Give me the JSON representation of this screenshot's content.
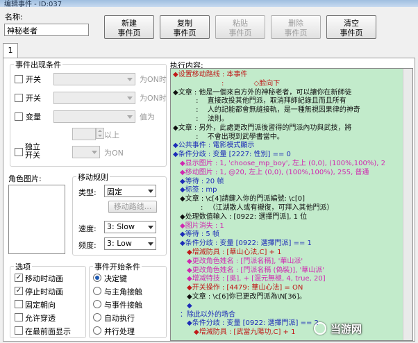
{
  "window": {
    "title": "编辑事件 - ID:037"
  },
  "name_field": {
    "label": "名称:",
    "value": "神秘老者"
  },
  "toolbar": {
    "buttons": [
      {
        "line1": "新建",
        "line2": "事件页",
        "enabled": true
      },
      {
        "line1": "复制",
        "line2": "事件页",
        "enabled": true
      },
      {
        "line1": "粘贴",
        "line2": "事件页",
        "enabled": false
      },
      {
        "line1": "删除",
        "line2": "事件页",
        "enabled": false
      },
      {
        "line1": "清空",
        "line2": "事件页",
        "enabled": true
      }
    ]
  },
  "tabs": [
    {
      "label": "1"
    }
  ],
  "conditions": {
    "title": "事件出现条件",
    "switch1": {
      "label": "开关",
      "suffix": "为ON时"
    },
    "switch2": {
      "label": "开关",
      "suffix": "为ON时"
    },
    "variable": {
      "label": "变量",
      "suffix": "值为",
      "above": "以上"
    },
    "self_switch": {
      "label1": "独立",
      "label2": "开关",
      "suffix": "为ON"
    }
  },
  "graphic": {
    "label": "角色图片:"
  },
  "movement": {
    "title": "移动规则",
    "type_label": "类型:",
    "type_value": "固定",
    "route_button": "移动路线...",
    "speed_label": "速度:",
    "speed_value": "3: Slow",
    "freq_label": "频度:",
    "freq_value": "3: Low"
  },
  "options": {
    "title": "选项",
    "items": [
      {
        "label": "移动时动画",
        "checked": true
      },
      {
        "label": "停止时动画",
        "checked": true
      },
      {
        "label": "固定朝向",
        "checked": false
      },
      {
        "label": "允许穿透",
        "checked": false
      },
      {
        "label": "在最前面显示",
        "checked": false
      }
    ]
  },
  "trigger": {
    "title": "事件开始条件",
    "items": [
      {
        "label": "决定键",
        "selected": true
      },
      {
        "label": "与主角接触",
        "selected": false
      },
      {
        "label": "与事件接触",
        "selected": false
      },
      {
        "label": "自动执行",
        "selected": false
      },
      {
        "label": "并行处理",
        "selected": false
      }
    ]
  },
  "contents": {
    "label": "执行内容:",
    "lines": [
      {
        "text": "◆设置移动路线 : 本事件",
        "color": "#c01818"
      },
      {
        "text": "　　　　　　　: 　　　　◇脸向下",
        "color": "#c01818"
      },
      {
        "text": "◆文章 : 他是一個來自方外的神秘老者，可以讓你在新師徒",
        "color": "#101010"
      },
      {
        "text": "　　　 : 　直接改投其他門派，取消拜師紀錄且而且所有",
        "color": "#101010"
      },
      {
        "text": "　　　 : 　人的記能都會無縫接軌，是一種無視因果律的神奇",
        "color": "#101010"
      },
      {
        "text": "　　　 : 　法則。",
        "color": "#101010"
      },
      {
        "text": "◆文章 : 另外，此處更改門派後習得的門派內功與武技，將",
        "color": "#101010"
      },
      {
        "text": "　　　 : 　不會出現到武學書當中。",
        "color": "#101010"
      },
      {
        "text": "◆公共事件 : 電影模式顯示",
        "color": "#1c2bb7"
      },
      {
        "text": "◆条件分歧 : 变量 [2227: 性別] == 0",
        "color": "#1c2bb7"
      },
      {
        "text": "　◆显示图片 : 1, 'choose_mp_boy', 左上 (0,0), (100%,100%), 2",
        "color": "#d028b0"
      },
      {
        "text": "　◆移动图片 : 1, @20, 左上 (0,0), (100%,100%), 255, 普通",
        "color": "#d028b0"
      },
      {
        "text": "　◆等待 : 20 帧",
        "color": "#1c2bb7"
      },
      {
        "text": "　◆标签 : mp",
        "color": "#1c2bb7"
      },
      {
        "text": "　◆文章 : \\c[4]請鍵入你的門派編號: \\c[0]",
        "color": "#101010"
      },
      {
        "text": "　　　　: 　（江湖散人或有襯復，可拜入其他門派）",
        "color": "#101010"
      },
      {
        "text": "　◆处理数值输入 : [0922: 選擇門派], 1 位",
        "color": "#101010"
      },
      {
        "text": "　◆图片消失 : 1",
        "color": "#d028b0"
      },
      {
        "text": "　◆等待 : 5 帧",
        "color": "#1c2bb7"
      },
      {
        "text": "　◆条件分歧 : 变量 [0922: 選擇門派] == 1",
        "color": "#1c2bb7"
      },
      {
        "text": "　　◆增減防具 : [華山心法,C] + 1",
        "color": "#c01818"
      },
      {
        "text": "　　◆更改角色姓名 : [門派名稱], '華山派'",
        "color": "#d028b0"
      },
      {
        "text": "　　◆更改角色姓名 : [門派名稱 (偽裝)], '華山派'",
        "color": "#d028b0"
      },
      {
        "text": "　　◆增减特技 : [吳], + [混元無極, 4, true, 20]",
        "color": "#d028b0"
      },
      {
        "text": "　　◆开关操作 : [4479: 華山心法] = ON",
        "color": "#c01818"
      },
      {
        "text": "　　◆文章 : \\c[6]你已更改門派為\\N[36]。",
        "color": "#101010"
      },
      {
        "text": "　　◆",
        "color": "#1c2bb7"
      },
      {
        "text": "　：除此以外的场合",
        "color": "#1c2bb7"
      },
      {
        "text": "　　◆条件分歧 : 变量 [0922: 選擇門派] == 2",
        "color": "#1c2bb7"
      },
      {
        "text": "　　　◆增減防具 : [武當九陽功,C] + 1",
        "color": "#c01818"
      }
    ]
  },
  "watermark": {
    "text": "当游网"
  }
}
